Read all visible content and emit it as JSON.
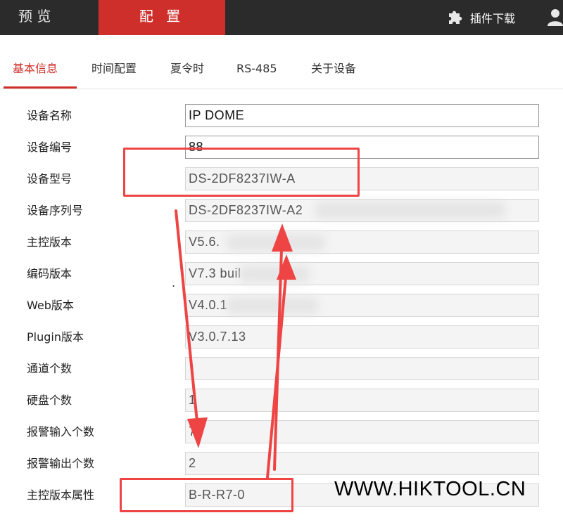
{
  "topbar": {
    "preview_label": "预 览",
    "config_label": "配 置",
    "plugin_label": "插件下载",
    "plugin_icon": "puzzle-icon",
    "user_icon": "user-icon",
    "accent_color": "#cf2f2b"
  },
  "subtabs": [
    {
      "label": "基本信息",
      "active": true
    },
    {
      "label": "时间配置",
      "active": false
    },
    {
      "label": "夏令时",
      "active": false
    },
    {
      "label": "RS-485",
      "active": false
    },
    {
      "label": "关于设备",
      "active": false
    }
  ],
  "form": {
    "device_name": {
      "label": "设备名称",
      "value": "IP DOME"
    },
    "device_number": {
      "label": "设备编号",
      "value": "88"
    },
    "device_model": {
      "label": "设备型号",
      "value": "DS-2DF8237IW-A"
    },
    "serial_number": {
      "label": "设备序列号",
      "value": "DS-2DF8237IW-A2"
    },
    "firmware_version": {
      "label": "主控版本",
      "value": "V5.6."
    },
    "encoding_version": {
      "label": "编码版本",
      "value": "V7.3 buil"
    },
    "web_version": {
      "label": "Web版本",
      "value": "V4.0.1"
    },
    "plugin_version": {
      "label": "Plugin版本",
      "value": "V3.0.7.13"
    },
    "channel_count": {
      "label": "通道个数",
      "value": ""
    },
    "hdd_count": {
      "label": "硬盘个数",
      "value": "1"
    },
    "alarm_input_count": {
      "label": "报警输入个数",
      "value": "7"
    },
    "alarm_output_count": {
      "label": "报警输出个数",
      "value": "2"
    },
    "firmware_property": {
      "label": "主控版本属性",
      "value": "B-R-R7-0"
    }
  },
  "misc": {
    "dot": "."
  },
  "annotation_color": "#ee4444",
  "watermark": "WWW.HIKTOOL.CN"
}
